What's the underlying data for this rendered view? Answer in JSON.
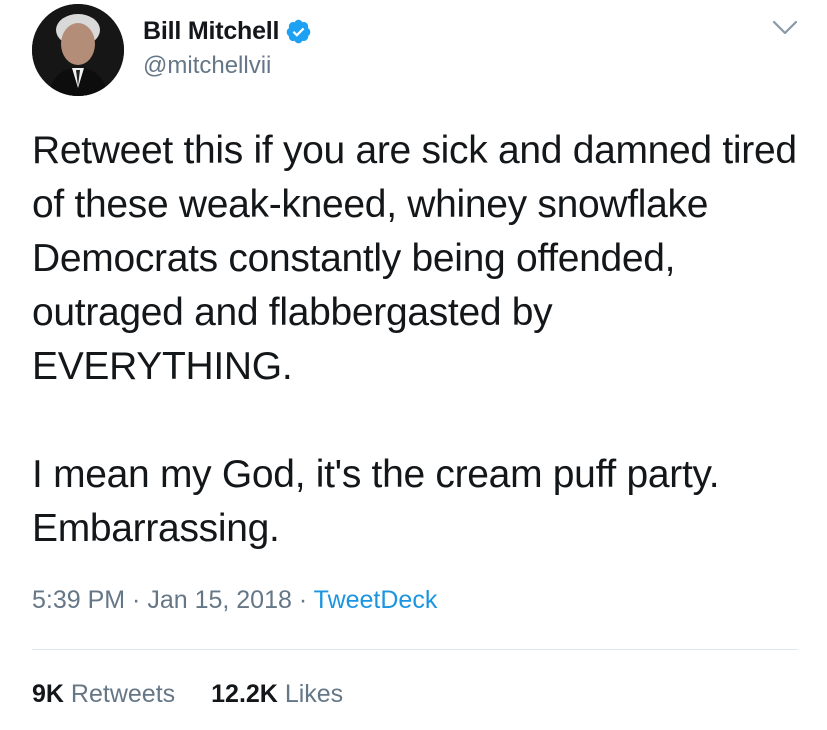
{
  "user": {
    "display_name": "Bill Mitchell",
    "handle": "@mitchellvii",
    "verified": true,
    "avatar_icon": "profile-photo",
    "verified_icon": "verified-badge-icon"
  },
  "menu": {
    "caret_icon": "chevron-down-icon"
  },
  "tweet": {
    "text": "Retweet this if you are sick and damned tired of these weak-kneed, whiney snowflake Democrats constantly being offended, outraged and flabbergasted by EVERYTHING.\n\nI mean my God, it's the cream puff party. Embarrassing."
  },
  "meta": {
    "time": "5:39 PM",
    "separator1": " · ",
    "date": "Jan 15, 2018",
    "separator2": " · ",
    "source": "TweetDeck"
  },
  "stats": {
    "retweets_count": "9K",
    "retweets_label": "Retweets",
    "likes_count": "12.2K",
    "likes_label": "Likes"
  },
  "colors": {
    "text_primary": "#14171a",
    "text_secondary": "#657786",
    "link": "#1b95e0",
    "verified": "#1da1f2",
    "divider": "#e1e8ed"
  }
}
